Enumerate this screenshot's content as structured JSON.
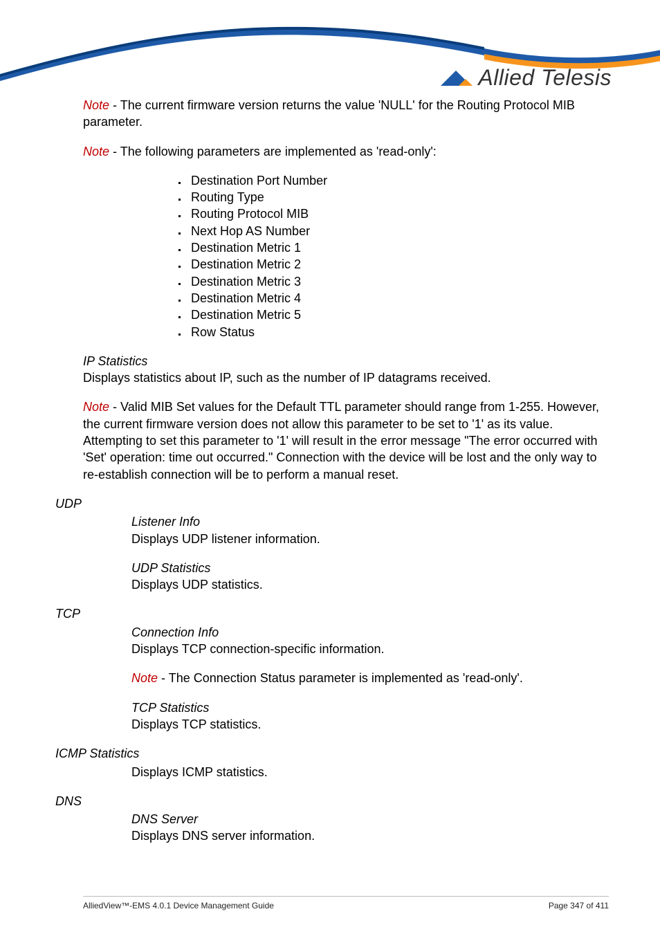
{
  "logo": {
    "text": "Allied Telesis"
  },
  "note1": {
    "label": "Note",
    "text": " - The current firmware version returns the value 'NULL' for the Routing Protocol MIB parameter."
  },
  "note2": {
    "label": "Note",
    "text": " - The following parameters are implemented as 'read-only':"
  },
  "readonly_params": [
    "Destination Port Number",
    "Routing Type",
    "Routing Protocol MIB",
    "Next Hop AS Number",
    "Destination Metric 1",
    "Destination Metric 2",
    "Destination Metric 3",
    "Destination Metric 4",
    "Destination Metric 5",
    "Row Status"
  ],
  "ip_statistics": {
    "heading": " IP Statistics",
    "body": "Displays statistics about IP, such as the number of IP datagrams received."
  },
  "note3": {
    "label": "Note",
    "text": " - Valid MIB Set values for the Default TTL parameter should range from 1-255. However, the current firmware version does not allow this parameter to be set to '1' as its value. Attempting to set this parameter to '1' will result in the error message \"The error occurred with 'Set' operation: time out occurred.\" Connection with the device will be lost and the only way to re-establish connection will be to perform a manual reset."
  },
  "udp": {
    "label": "UDP",
    "listener": {
      "heading": "Listener Info",
      "body": "Displays UDP listener information."
    },
    "stats": {
      "heading": "UDP Statistics",
      "body": "Displays UDP statistics."
    }
  },
  "tcp": {
    "label": "TCP",
    "conn": {
      "heading": "Connection Info",
      "body": "Displays TCP connection-specific information."
    },
    "note": {
      "label": "Note",
      "text": " - The Connection Status parameter is implemented as 'read-only'."
    },
    "stats": {
      "heading": "TCP Statistics",
      "body": "Displays TCP statistics."
    }
  },
  "icmp": {
    "label": "ICMP Statistics",
    "body": "Displays ICMP statistics."
  },
  "dns": {
    "label": "DNS",
    "server": {
      "heading": "DNS Server",
      "body": "Displays DNS server information."
    }
  },
  "footer": {
    "left": "AlliedView™-EMS 4.0.1 Device Management Guide",
    "right": "Page 347 of 411"
  }
}
